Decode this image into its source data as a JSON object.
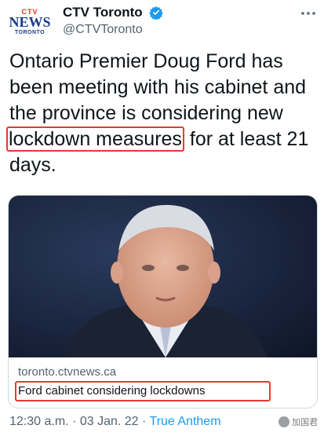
{
  "author": {
    "avatar_top": "CTV",
    "avatar_mid": "NEWS",
    "avatar_bottom": "TORONTO",
    "display_name": "CTV Toronto",
    "handle": "@CTVToronto"
  },
  "tweet": {
    "text_before": "Ontario Premier Doug Ford has been meeting with his cabinet and the province is considering new",
    "text_highlight": "lockdown measures",
    "text_after": "for at least 21 days."
  },
  "card": {
    "domain": "toronto.ctvnews.ca",
    "title": "Ford cabinet considering lockdowns"
  },
  "meta": {
    "time": "12:30 a.m.",
    "separator": "·",
    "date": "03 Jan. 22",
    "source": "True Anthem"
  },
  "watermark": {
    "text": "加国君"
  },
  "colors": {
    "highlight_border": "#e63b2e",
    "verified": "#1d9bf0",
    "link": "#1d9bf0",
    "secondary_text": "#536471"
  }
}
